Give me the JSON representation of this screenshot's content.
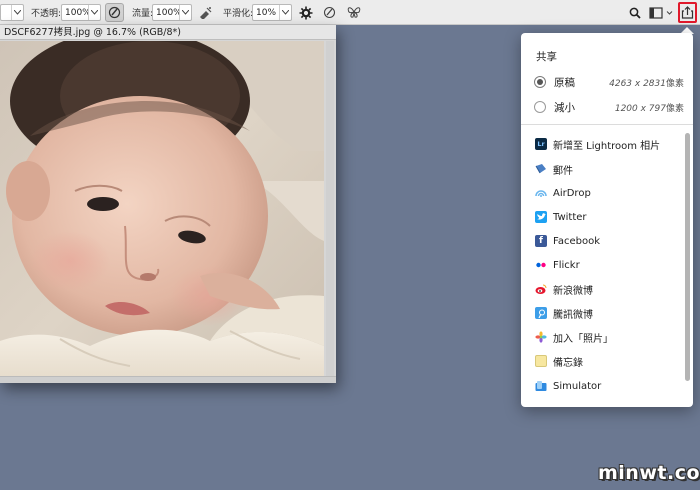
{
  "toolbar": {
    "opacity_label": "不透明:",
    "opacity_value": "100%",
    "flow_label": "流量:",
    "flow_value": "100%",
    "smoothing_label": "平滑化:",
    "smoothing_value": "10%",
    "first_value": ""
  },
  "document": {
    "tab_title": "DSCF6277拷貝.jpg @ 16.7% (RGB/8*)"
  },
  "share_popup": {
    "title": "共享",
    "sizes": [
      {
        "label": "原稿",
        "dims": "4263 x 2831",
        "unit": "像素",
        "selected": true
      },
      {
        "label": "減小",
        "dims": "1200 x 797",
        "unit": "像素",
        "selected": false
      }
    ],
    "items": [
      {
        "label": "新增至 Lightroom 相片",
        "icon": "lightroom-icon",
        "icon_text": "Lr",
        "color": "#0b2a45"
      },
      {
        "label": "郵件",
        "icon": "mail-icon",
        "icon_text": "",
        "color": "#4a7fc4"
      },
      {
        "label": "AirDrop",
        "icon": "airdrop-icon",
        "icon_text": "",
        "color": "#6ab6ee"
      },
      {
        "label": "Twitter",
        "icon": "twitter-icon",
        "icon_text": "t",
        "color": "#1da1f2"
      },
      {
        "label": "Facebook",
        "icon": "facebook-icon",
        "icon_text": "f",
        "color": "#3b5998"
      },
      {
        "label": "Flickr",
        "icon": "flickr-icon",
        "icon_text": "",
        "color": "#ffffff"
      },
      {
        "label": "新浪微博",
        "icon": "weibo-icon",
        "icon_text": "",
        "color": "#e6162d"
      },
      {
        "label": "騰訊微博",
        "icon": "tencent-weibo-icon",
        "icon_text": "",
        "color": "#3d9ee8"
      },
      {
        "label": "加入「照片」",
        "icon": "photos-icon",
        "icon_text": "",
        "color": "#f4a03a"
      },
      {
        "label": "備忘錄",
        "icon": "notes-icon",
        "icon_text": "",
        "color": "#f7e7a0"
      },
      {
        "label": "Simulator",
        "icon": "simulator-icon",
        "icon_text": "",
        "color": "#2f8ae0"
      }
    ]
  },
  "watermark": "minwt.com",
  "colors": {
    "workspace": "#6b7891",
    "share_highlight": "#e0192b"
  }
}
